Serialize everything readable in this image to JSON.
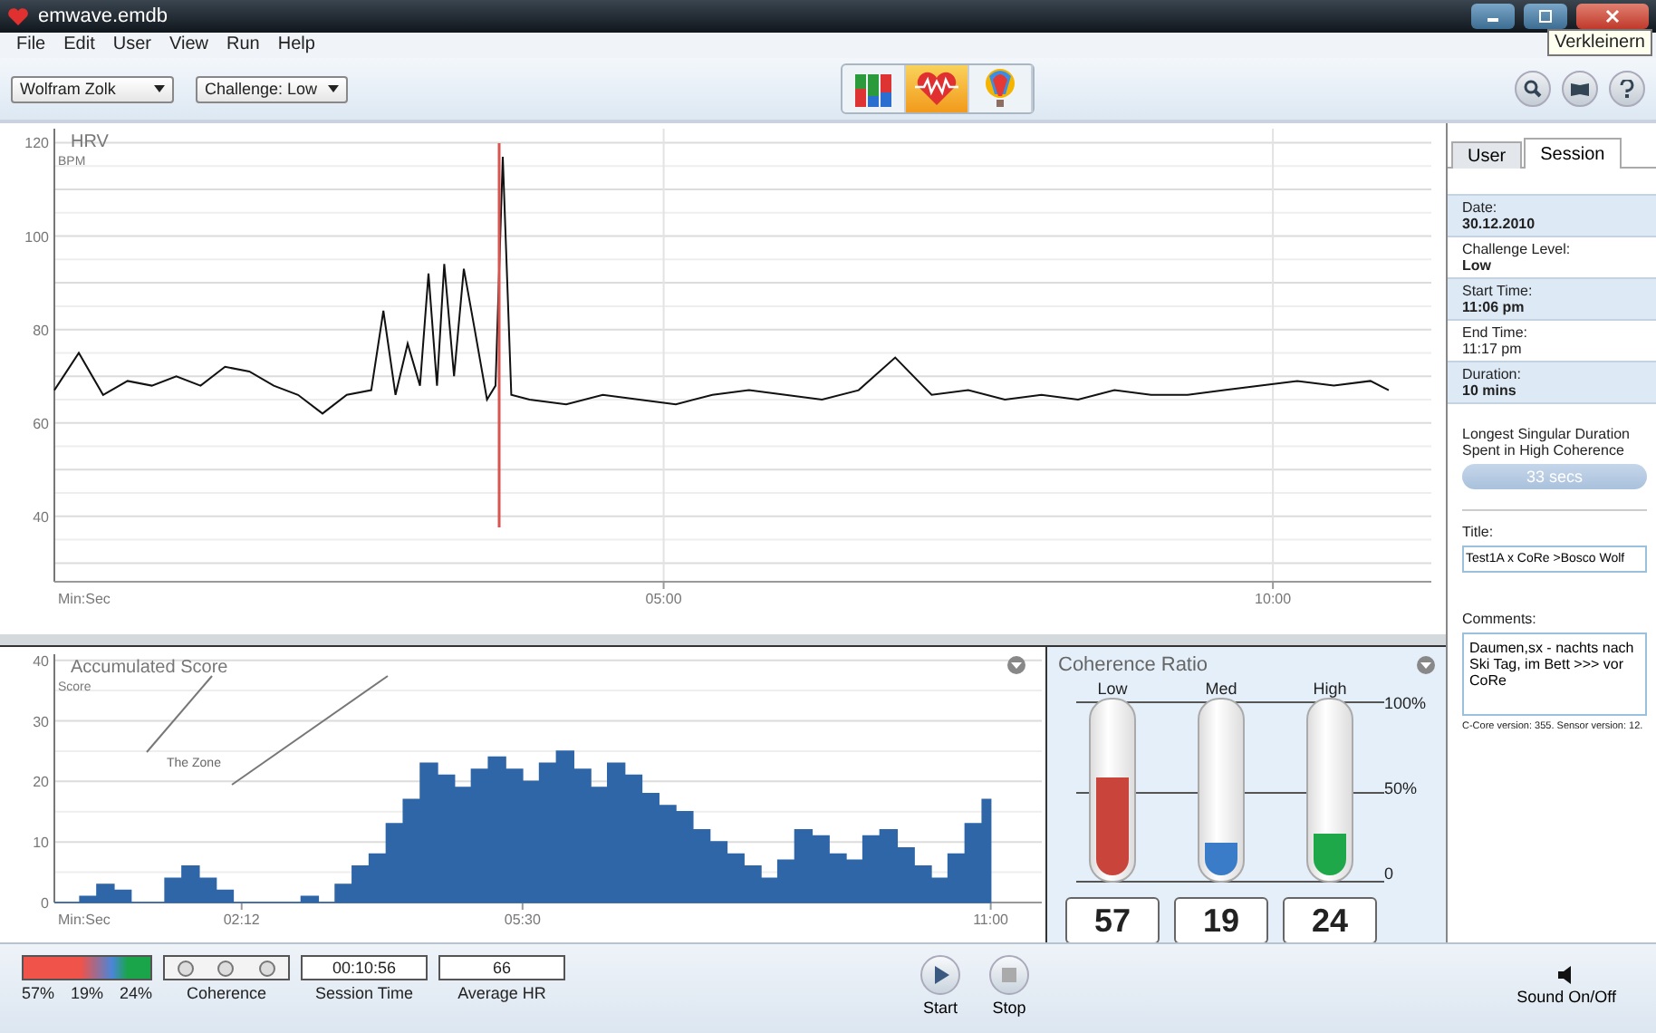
{
  "window": {
    "title": "emwave.emdb",
    "tooltip": "Verkleinern"
  },
  "menu": [
    "File",
    "Edit",
    "User",
    "View",
    "Run",
    "Help"
  ],
  "toolbar": {
    "user_select": "Wolfram Zolk",
    "challenge_select": "Challenge: Low",
    "views": [
      {
        "kind": "bars",
        "selected": false
      },
      {
        "kind": "heart",
        "selected": true
      },
      {
        "kind": "balloon",
        "selected": false
      }
    ]
  },
  "hrv": {
    "chart_data": {
      "type": "line",
      "title": "HRV",
      "xlabel": "Min:Sec",
      "ylabel": "BPM",
      "grid": true,
      "xlim": [
        0,
        11.3
      ],
      "ylim": [
        26,
        123
      ],
      "yticks": [
        40,
        60,
        80,
        100,
        120
      ],
      "xticks": [
        {
          "value": 5,
          "label": "05:00"
        },
        {
          "value": 10,
          "label": "10:00"
        }
      ],
      "x": [
        0,
        0.2,
        0.4,
        0.6,
        0.8,
        1.0,
        1.2,
        1.4,
        1.6,
        1.8,
        2.0,
        2.2,
        2.4,
        2.6,
        2.7,
        2.8,
        2.9,
        3.0,
        3.07,
        3.14,
        3.2,
        3.28,
        3.36,
        3.45,
        3.55,
        3.62,
        3.68,
        3.75,
        3.9,
        4.2,
        4.5,
        4.8,
        5.1,
        5.4,
        5.7,
        6.0,
        6.3,
        6.6,
        6.9,
        7.2,
        7.5,
        7.8,
        8.1,
        8.4,
        8.7,
        9.0,
        9.3,
        9.6,
        9.9,
        10.2,
        10.5,
        10.8,
        10.95
      ],
      "series": [
        {
          "color": "#111111",
          "values": [
            67,
            75,
            66,
            69,
            68,
            70,
            68,
            72,
            71,
            68,
            66,
            62,
            66,
            67,
            84,
            66,
            77,
            68,
            92,
            68,
            94,
            70,
            93,
            80,
            65,
            68,
            117,
            66,
            65,
            64,
            66,
            65,
            64,
            66,
            67,
            66,
            65,
            67,
            74,
            66,
            67,
            65,
            66,
            65,
            67,
            66,
            66,
            67,
            68,
            69,
            68,
            69,
            67
          ]
        }
      ]
    }
  },
  "score": {
    "chart_data": {
      "type": "area",
      "title": "Accumulated Score",
      "xlabel": "Min:Sec",
      "ylabel": "Score",
      "grid": true,
      "xlim": [
        0,
        11.6
      ],
      "ylim": [
        0,
        41
      ],
      "yticks": [
        0,
        10,
        20,
        30,
        40
      ],
      "xticks": [
        {
          "value": 2.2,
          "label": "02:12"
        },
        {
          "value": 5.5,
          "label": "05:30"
        },
        {
          "value": 11,
          "label": "11:00"
        }
      ],
      "annotations": [
        "The Zone"
      ],
      "x": [
        0,
        0.2,
        0.4,
        0.6,
        0.8,
        1.0,
        1.2,
        1.4,
        1.6,
        1.8,
        2.0,
        2.2,
        2.4,
        2.6,
        2.8,
        3.0,
        3.2,
        3.4,
        3.6,
        3.8,
        4.0,
        4.2,
        4.4,
        4.6,
        4.8,
        5.0,
        5.2,
        5.4,
        5.6,
        5.8,
        6.0,
        6.2,
        6.4,
        6.6,
        6.8,
        7.0,
        7.2,
        7.4,
        7.6,
        7.8,
        8.0,
        8.2,
        8.4,
        8.6,
        8.8,
        9.0,
        9.2,
        9.4,
        9.6,
        9.8,
        10.0,
        10.2,
        10.4,
        10.6,
        10.8,
        11.0
      ],
      "series": [
        {
          "color": "#2f66a8",
          "values": [
            0,
            0,
            1,
            3,
            2,
            0,
            0,
            4,
            6,
            4,
            2,
            0,
            0,
            0,
            0,
            1,
            0,
            3,
            6,
            8,
            13,
            17,
            23,
            21,
            19,
            22,
            24,
            22,
            20,
            23,
            25,
            22,
            19,
            23,
            21,
            18,
            16,
            15,
            12,
            10,
            8,
            6,
            4,
            7,
            12,
            11,
            8,
            7,
            11,
            12,
            9,
            6,
            4,
            8,
            13,
            17
          ]
        }
      ]
    }
  },
  "coherence": {
    "title": "Coherence Ratio",
    "scale": [
      "100%",
      "50%",
      "0"
    ],
    "bars": [
      {
        "label": "Low",
        "level": 0.57,
        "color": "#c9453b",
        "value": "57"
      },
      {
        "label": "Med",
        "level": 0.19,
        "color": "#3a7cc7",
        "value": "19"
      },
      {
        "label": "High",
        "level": 0.24,
        "color": "#1fa84a",
        "value": "24"
      }
    ]
  },
  "sidebar": {
    "tabs": [
      {
        "label": "User",
        "selected": false
      },
      {
        "label": "Session",
        "selected": true
      }
    ],
    "fields": [
      {
        "label": "Date:",
        "value": "30.12.2010",
        "shaded": true,
        "bold": true
      },
      {
        "label": "Challenge Level:",
        "value": "Low",
        "shaded": false,
        "bold": true
      },
      {
        "label": "Start Time:",
        "value": "11:06 pm",
        "shaded": true,
        "bold": true
      },
      {
        "label": "End Time:",
        "value": "11:17 pm",
        "shaded": false,
        "bold": false
      },
      {
        "label": "Duration:",
        "value": "10 mins",
        "shaded": true,
        "bold": true
      }
    ],
    "longest_label": "Longest Singular Duration Spent in High Coherence",
    "longest_value": "33 secs",
    "title_label": "Title:",
    "title_value": "Test1A x CoRe >Bosco Wolf",
    "comments_label": "Comments:",
    "comments_value": "Daumen,sx - nachts nach Ski Tag, im Bett >>> vor CoRe",
    "version": "C-Core version: 355.  Sensor version: 12."
  },
  "status_bar": {
    "ratio": [
      "57%",
      "19%",
      "24%"
    ],
    "lights": [
      {
        "on": false
      },
      {
        "on": false
      },
      {
        "on": false
      }
    ],
    "coherence_label": "Coherence",
    "session_time": "00:10:56",
    "session_time_label": "Session Time",
    "average_hr": "66",
    "average_hr_label": "Average HR",
    "start": "Start",
    "stop": "Stop",
    "sound": "Sound On/Off"
  }
}
